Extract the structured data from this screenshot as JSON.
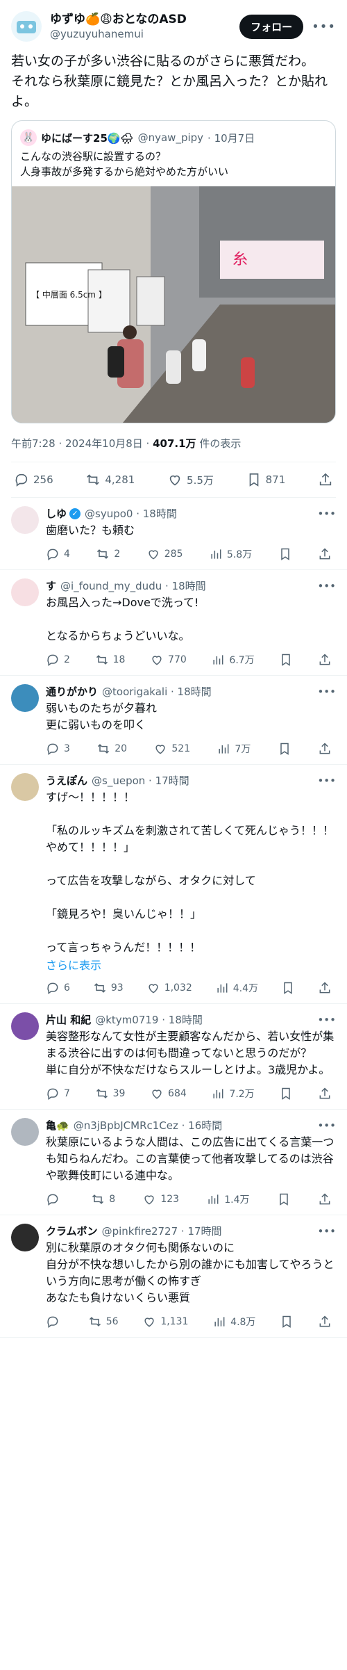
{
  "post": {
    "display_name": "ゆずゆ🍊😩おとなのASD",
    "handle": "@yuzuyuhanemui",
    "follow_label": "フォロー",
    "text": "若い女の子が多い渋谷に貼るのがさらに悪質だわ。\nそれなら秋葉原に鏡見た？とか風呂入った？とか貼れよ。",
    "quote": {
      "display_name": "ゆにばーす25🌍🌧",
      "handle": "@nyaw_pipy",
      "date": "· 10月7日",
      "text": "こんなの渋谷駅に設置するの？\n人身事故が多発するから絶対やめた方がいい",
      "photo_sign": "【 中層面 6.5cm 】",
      "photo_ad": "糸"
    },
    "timestamp": "午前7:28 · 2024年10月8日 · ",
    "views": "407.1万",
    "views_suffix": " 件の表示",
    "stats": {
      "replies": "256",
      "reposts": "4,281",
      "likes": "5.5万",
      "bookmarks": "871"
    }
  },
  "replies": [
    {
      "name": "しゆ",
      "verified": true,
      "handle": "@syupo0 · 18時間",
      "text": "歯磨いた？も頼む",
      "replies": "4",
      "reposts": "2",
      "likes": "285",
      "views": "5.8万",
      "avatar_color": "#f3e6ea"
    },
    {
      "name": "す",
      "verified": false,
      "handle": "@i_found_my_dudu · 18時間",
      "text": "お風呂入った→Doveで洗って!\n\nとなるからちょうどいいな。",
      "replies": "2",
      "reposts": "18",
      "likes": "770",
      "views": "6.7万",
      "avatar_color": "#f7dfe3"
    },
    {
      "name": "通りがかり",
      "verified": false,
      "handle": "@toorigakali · 18時間",
      "text": "弱いものたちが夕暮れ\n更に弱いものを叩く",
      "replies": "3",
      "reposts": "20",
      "likes": "521",
      "views": "7万",
      "avatar_color": "#3c8dbc"
    },
    {
      "name": "うえぽん",
      "verified": false,
      "handle": "@s_uepon · 17時間",
      "text": "すげ〜！！！！！\n\n「私のルッキズムを刺激されて苦しくて死んじゃう！！！やめて！！！！」\n\nって広告を攻撃しながら、オタクに対して\n\n「鏡見ろや！臭いんじゃ！！」\n\nって言っちゃうんだ！！！！！",
      "show_more": "さらに表示",
      "replies": "6",
      "reposts": "93",
      "likes": "1,032",
      "views": "4.4万",
      "avatar_color": "#d9c8a4"
    },
    {
      "name": "片山 和紀",
      "verified": false,
      "handle": "@ktym0719 · 18時間",
      "text": "美容整形なんて女性が主要顧客なんだから、若い女性が集まる渋谷に出すのは何も間違ってないと思うのだが？\n単に自分が不快なだけならスルーしとけよ。3歳児かよ。",
      "replies": "7",
      "reposts": "39",
      "likes": "684",
      "views": "7.2万",
      "avatar_color": "#7b4fa8"
    },
    {
      "name": "亀🐢",
      "verified": false,
      "handle": "@n3jBpbJCMRc1Cez · 16時間",
      "text": "秋葉原にいるような人間は、この広告に出てくる言葉一つも知らねんだわ。この言葉使って他者攻撃してるのは渋谷や歌舞伎町にいる連中な。",
      "replies": "",
      "reposts": "8",
      "likes": "123",
      "views": "1.4万",
      "avatar_color": "#b0b7bf"
    },
    {
      "name": "クラムボン",
      "verified": false,
      "handle": "@pinkfire2727 · 17時間",
      "text": "別に秋葉原のオタク何も関係ないのに\n自分が不快な想いしたから別の誰かにも加害してやろうという方向に思考が働くの怖すぎ\nあなたも負けないくらい悪質",
      "replies": "",
      "reposts": "56",
      "likes": "1,131",
      "views": "4.8万",
      "avatar_color": "#2b2b2b"
    }
  ]
}
